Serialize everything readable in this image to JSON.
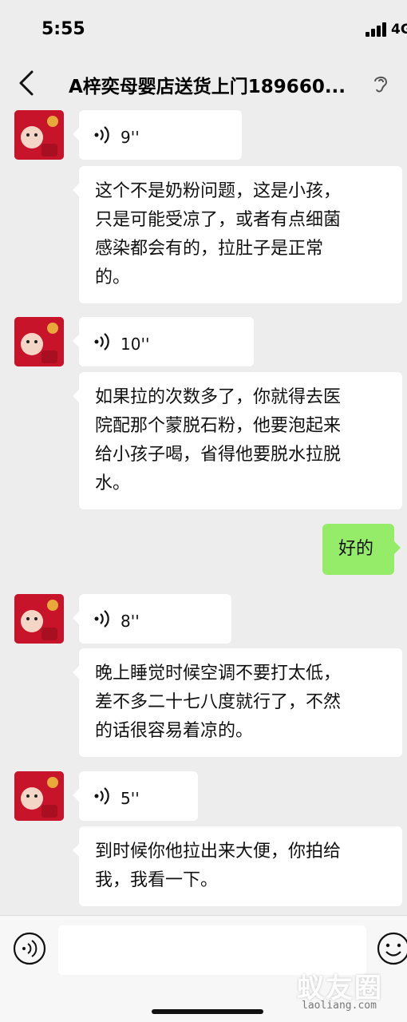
{
  "status_bar": {
    "time": "5:55",
    "network": "4G"
  },
  "header": {
    "title": "A梓奕母婴店送货上门189660..."
  },
  "messages": [
    {
      "type": "voice",
      "duration": "9''"
    },
    {
      "type": "text",
      "lines": [
        "这个不是奶粉问题，这是小孩，",
        "只是可能受凉了，或者有点细菌",
        "感染都会有的，拉肚子是正常",
        "的。"
      ]
    },
    {
      "type": "voice",
      "duration": "10''"
    },
    {
      "type": "text",
      "lines": [
        "如果拉的次数多了，你就得去医",
        "院配那个蒙脱石粉，他要泡起来",
        "给小孩子喝，省得他要脱水拉脱",
        "水。"
      ]
    },
    {
      "type": "outgoing",
      "text": "好的"
    },
    {
      "type": "voice",
      "duration": "8''"
    },
    {
      "type": "text",
      "lines": [
        "晚上睡觉时候空调不要打太低，",
        "差不多二十七八度就行了，不然",
        "的话很容易着凉的。"
      ]
    },
    {
      "type": "voice",
      "duration": "5''"
    },
    {
      "type": "text",
      "lines": [
        "到时候你他拉出来大便，你拍给",
        "我，我看一下。"
      ]
    }
  ],
  "input": {
    "value": "",
    "placeholder": ""
  },
  "watermark": {
    "text": "蚁友圈",
    "sub": "laoliang.com"
  },
  "colors": {
    "background": "#ededed",
    "outgoing_bubble": "#95ec69",
    "incoming_bubble": "#ffffff",
    "avatar_red": "#c7142a"
  },
  "icons": [
    "back-arrow-icon",
    "ear-icon",
    "voice-wave-icon",
    "voice-toggle-icon",
    "emoji-icon"
  ]
}
